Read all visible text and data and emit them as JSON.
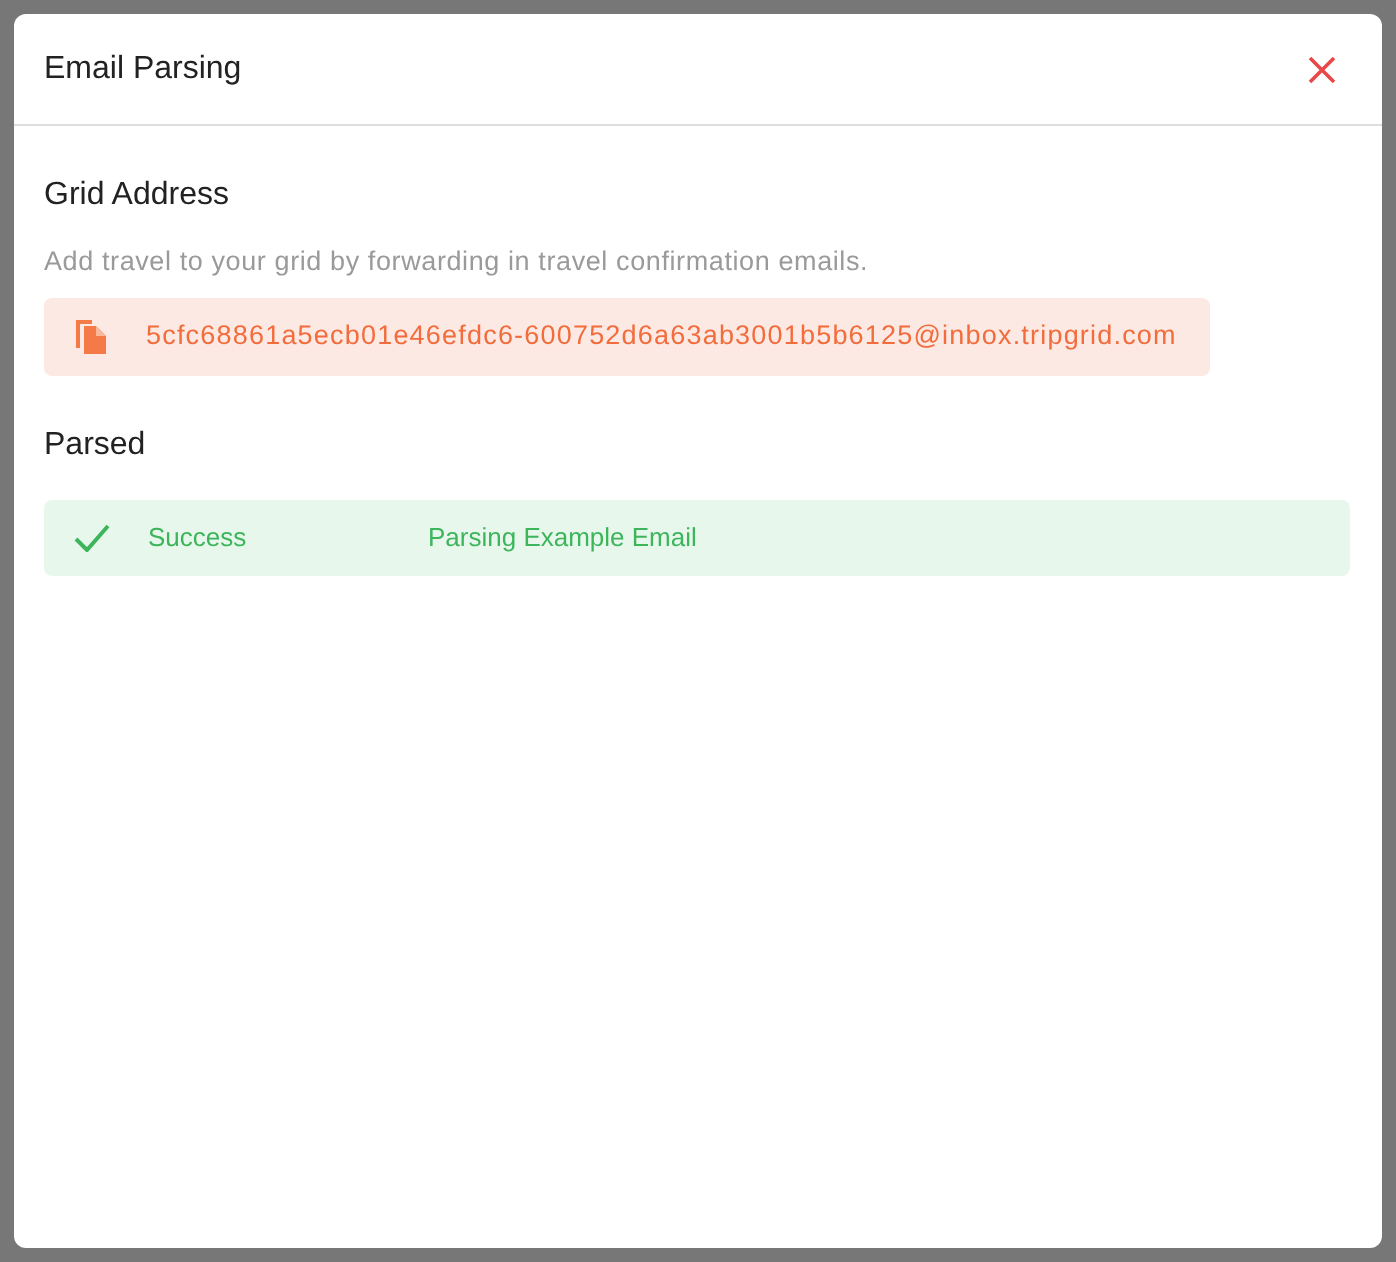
{
  "dialog": {
    "title": "Email Parsing"
  },
  "grid_address": {
    "heading": "Grid Address",
    "description": "Add travel to your grid by forwarding in travel confirmation emails.",
    "address": "5cfc68861a5ecb01e46efdc6-600752d6a63ab3001b5b6125@inbox.tripgrid.com"
  },
  "parsed": {
    "heading": "Parsed",
    "rows": [
      {
        "kind": "success",
        "status": "Success",
        "subject": "Parsing Example Email"
      }
    ]
  }
}
